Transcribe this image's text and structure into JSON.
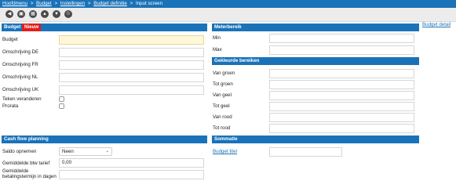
{
  "breadcrumb": {
    "items": [
      "Hoofdmenu",
      "Budget",
      "Instellingen",
      "Budget definitie"
    ],
    "current": "Input screen",
    "separator": ">"
  },
  "toolbar": {
    "icons": [
      "back-icon",
      "save-icon",
      "delete-icon",
      "up-icon",
      "down-icon",
      "copy-icon"
    ]
  },
  "budget_panel": {
    "title": "Budget",
    "badge": "Nieuw",
    "fields": {
      "budget": {
        "label": "Budget",
        "value": ""
      },
      "omschrijving_de": {
        "label": "Omschrijving DE",
        "value": ""
      },
      "omschrijving_fr": {
        "label": "Omschrijving FR",
        "value": ""
      },
      "omschrijving_nl": {
        "label": "Omschrijving NL",
        "value": ""
      },
      "omschrijving_uk": {
        "label": "Omschrijving UK",
        "value": ""
      }
    },
    "teken_veranderen": "Teken veranderen",
    "prorata": "Prorata"
  },
  "meterbereik_panel": {
    "title": "Meterbereik",
    "min_label": "Min",
    "max_label": "Max",
    "budget_detail_link": "Budget detail"
  },
  "kleuren_panel": {
    "title": "Gekleurde bereiken",
    "labels": [
      "Van groen",
      "Tot groen",
      "Van geel",
      "Tot geel",
      "Van rood",
      "Tot rood"
    ]
  },
  "cashflow_panel": {
    "title": "Cash flow planning",
    "saldo_label": "Saldo opnemen",
    "saldo_value": "Neen",
    "btw_label": "Gemiddelde btw tarief",
    "btw_value": "0,00",
    "betaling_label": "Gemiddelde betalingstermijn in dagen",
    "betaling_value": ""
  },
  "sommatie_panel": {
    "title": "Sommatie",
    "budget_titel_link": "Budget titel"
  },
  "colors": {
    "primary": "#1a72b8",
    "badge": "#e01e1e",
    "highlight_field": "#fff8d8"
  }
}
